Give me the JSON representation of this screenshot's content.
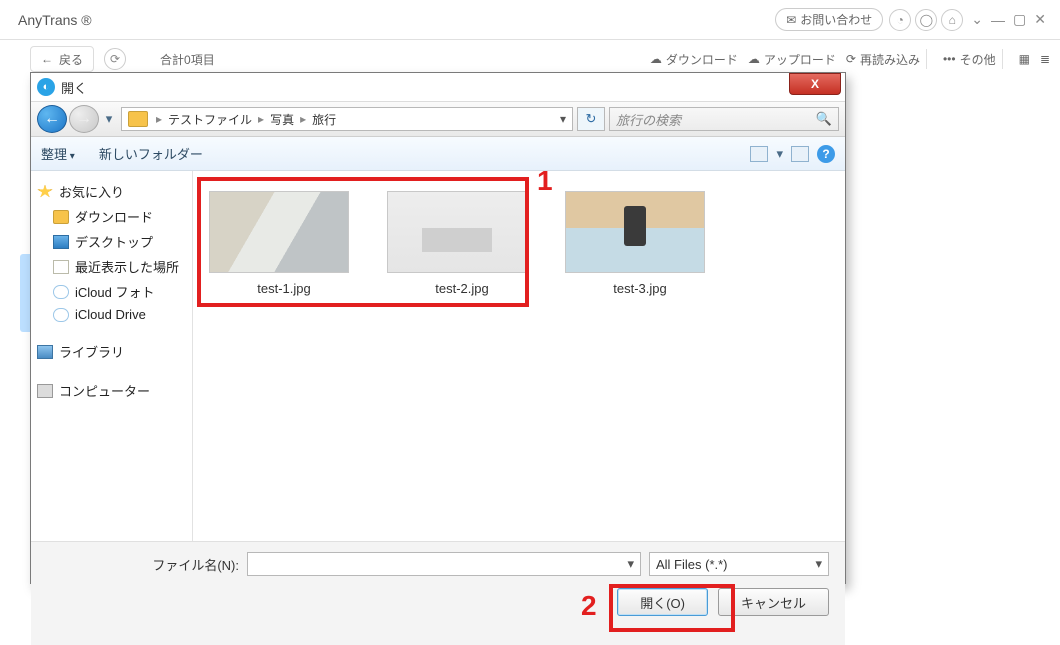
{
  "app": {
    "title": "AnyTrans ®",
    "contact": "お問い合わせ"
  },
  "toolbar": {
    "back": "戻る",
    "count": "合計0項目",
    "download": "ダウンロード",
    "upload": "アップロード",
    "reload": "再読み込み",
    "other": "その他"
  },
  "dialog": {
    "title": "開く",
    "breadcrumb": {
      "root": "テストファイル",
      "mid": "写真",
      "leaf": "旅行"
    },
    "search_placeholder": "旅行の検索",
    "organize": "整理",
    "new_folder": "新しいフォルダー",
    "filename_label": "ファイル名(N):",
    "filename_value": "",
    "filter": "All Files (*.*)",
    "open": "開く(O)",
    "cancel": "キャンセル"
  },
  "tree": {
    "favorites": "お気に入り",
    "downloads": "ダウンロード",
    "desktop": "デスクトップ",
    "recent": "最近表示した場所",
    "icloud_photo": "iCloud フォト",
    "icloud_drive": "iCloud Drive",
    "library": "ライブラリ",
    "computer": "コンピューター"
  },
  "files": {
    "f1": "test-1.jpg",
    "f2": "test-2.jpg",
    "f3": "test-3.jpg"
  },
  "annotations": {
    "n1": "1",
    "n2": "2"
  }
}
